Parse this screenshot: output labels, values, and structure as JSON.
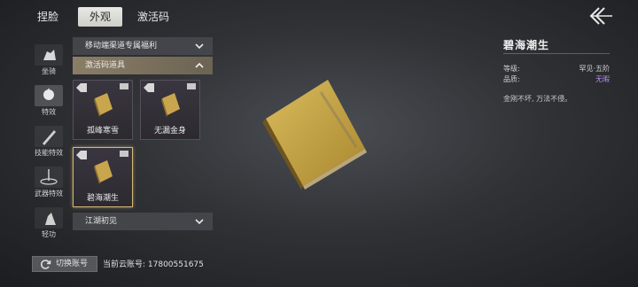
{
  "tabs": [
    {
      "label": "捏脸"
    },
    {
      "label": "外观"
    },
    {
      "label": "激活码"
    }
  ],
  "active_tab": "外观",
  "back_icon": "back-arrow-icon",
  "sidebar": {
    "items": [
      {
        "label": "坐骑",
        "icon": "mount-icon"
      },
      {
        "label": "特效",
        "icon": "effect-icon"
      },
      {
        "label": "技能特效",
        "icon": "skill-effect-icon"
      },
      {
        "label": "武器特效",
        "icon": "weapon-effect-icon"
      },
      {
        "label": "轻功",
        "icon": "qinggong-icon"
      }
    ],
    "active": "特效"
  },
  "sections": [
    {
      "label": "移动端渠道专属福利",
      "expanded": false
    },
    {
      "label": "激活码道具",
      "expanded": true
    },
    {
      "label": "江湖初见",
      "expanded": false
    }
  ],
  "items": [
    {
      "name": "孤峰寒雪",
      "selected": false
    },
    {
      "name": "无漏金身",
      "selected": false
    },
    {
      "name": "碧海潮生",
      "selected": true
    }
  ],
  "detail": {
    "title": "碧海潮生",
    "grade_label": "等级:",
    "grade_value": "罕见·五阶",
    "quality_label": "品质:",
    "quality_value": "无暇",
    "description": "金刚不坏, 万法不侵。"
  },
  "footer": {
    "switch_label": "切换账号",
    "account_text": "当前云账号: 17800551675"
  },
  "colors": {
    "accent_gold": "#d6b877",
    "quality_purple": "#b58be8",
    "open_header": "#8a7e66"
  }
}
